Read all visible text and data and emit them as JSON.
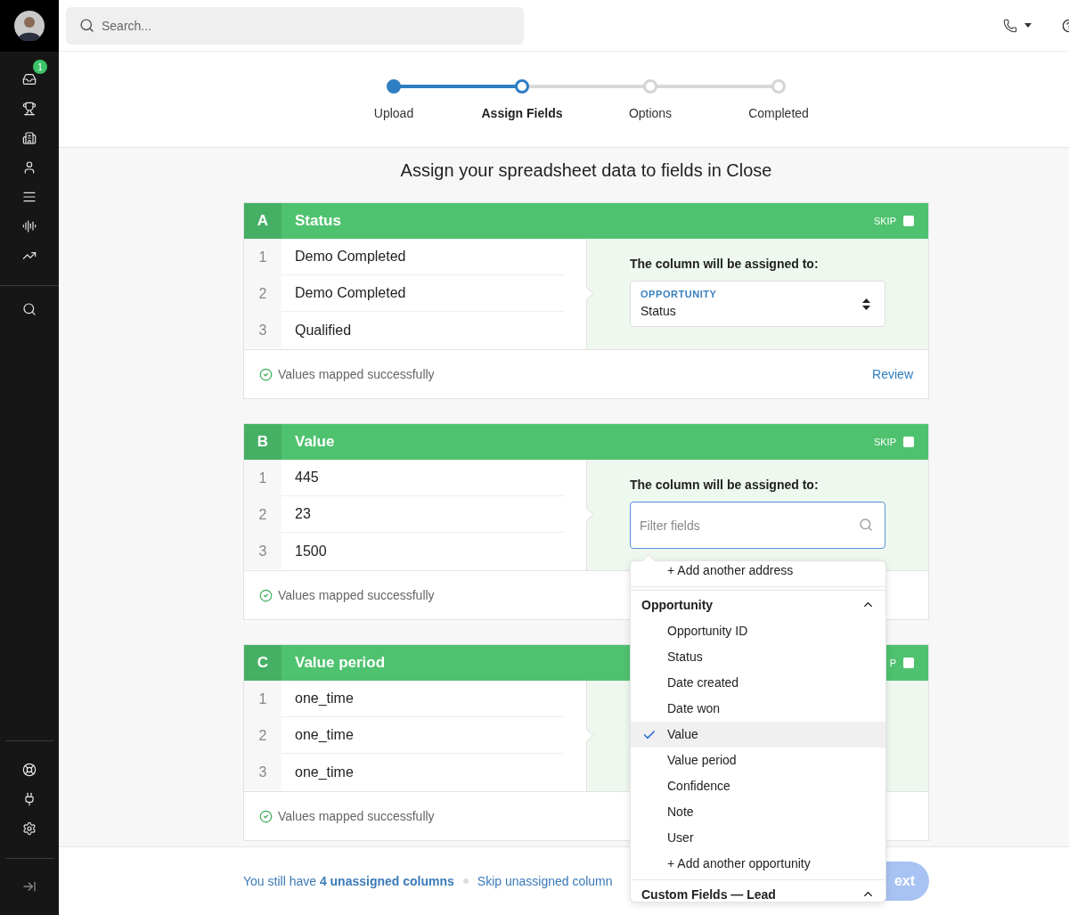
{
  "sidebar": {
    "badge": "1"
  },
  "search": {
    "placeholder": "Search..."
  },
  "steps": [
    {
      "label": "Upload",
      "done": true,
      "selected": false
    },
    {
      "label": "Assign Fields",
      "done": false,
      "selected": true
    },
    {
      "label": "Options",
      "done": false,
      "selected": false
    },
    {
      "label": "Completed",
      "done": false,
      "selected": false
    }
  ],
  "heading": "Assign your spreadsheet data to fields in Close",
  "columns": [
    {
      "letter": "A",
      "name": "Status",
      "skip_label": "SKIP",
      "skip_checked": false,
      "rows": [
        {
          "number": "1",
          "value": "Demo Completed"
        },
        {
          "number": "2",
          "value": "Demo Completed"
        },
        {
          "number": "3",
          "value": "Qualified"
        }
      ],
      "assignment": {
        "kind": "select",
        "label": "The column will be assigned to:",
        "group": "OPPORTUNITY",
        "field": "Status"
      },
      "status": "Values mapped successfully",
      "review": "Review"
    },
    {
      "letter": "B",
      "name": "Value",
      "skip_label": "SKIP",
      "skip_checked": false,
      "rows": [
        {
          "number": "1",
          "value": "445"
        },
        {
          "number": "2",
          "value": "23"
        },
        {
          "number": "3",
          "value": "1500"
        }
      ],
      "assignment": {
        "kind": "filter",
        "label": "The column will be assigned to:",
        "placeholder": "Filter fields"
      },
      "status": "Values mapped successfully"
    },
    {
      "letter": "C",
      "name": "Value period",
      "skip_label": "P",
      "skip_checked": false,
      "rows": [
        {
          "number": "1",
          "value": "one_time"
        },
        {
          "number": "2",
          "value": "one_time"
        },
        {
          "number": "3",
          "value": "one_time"
        }
      ],
      "status": "Values mapped successfully"
    }
  ],
  "dropdown": {
    "items": [
      {
        "kind": "add",
        "label": "+ Add another address"
      },
      {
        "kind": "group",
        "label": "Opportunity",
        "expanded": true
      },
      {
        "kind": "option",
        "label": "Opportunity ID",
        "selected": false
      },
      {
        "kind": "option",
        "label": "Status",
        "selected": false
      },
      {
        "kind": "option",
        "label": "Date created",
        "selected": false
      },
      {
        "kind": "option",
        "label": "Date won",
        "selected": false
      },
      {
        "kind": "option",
        "label": "Value",
        "selected": true
      },
      {
        "kind": "option",
        "label": "Value period",
        "selected": false
      },
      {
        "kind": "option",
        "label": "Confidence",
        "selected": false
      },
      {
        "kind": "option",
        "label": "Note",
        "selected": false
      },
      {
        "kind": "option",
        "label": "User",
        "selected": false
      },
      {
        "kind": "add",
        "label": "+ Add another opportunity"
      },
      {
        "kind": "group",
        "label": "Custom Fields — Lead",
        "expanded": true
      }
    ]
  },
  "footer": {
    "text": "You still have **4 unassigned columns**",
    "skip": "Skip unassigned column",
    "next": "ext"
  }
}
